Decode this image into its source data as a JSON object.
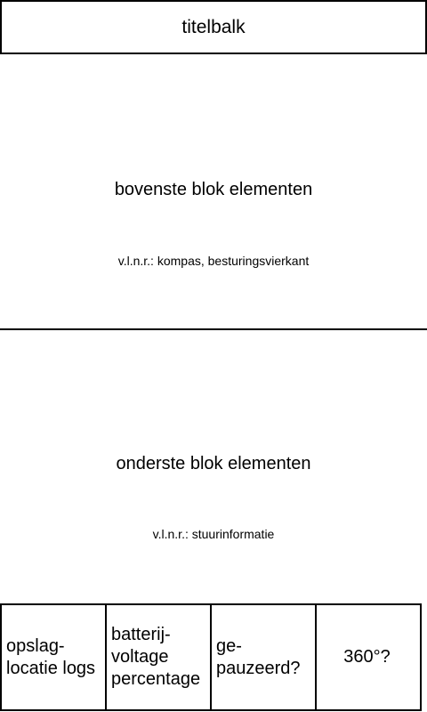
{
  "titlebar": {
    "label": "titelbalk"
  },
  "top_block": {
    "title": "bovenste blok elementen",
    "subtitle": "v.l.n.r.: kompas, besturingsvierkant"
  },
  "bottom_block": {
    "title": "onderste blok elementen",
    "subtitle": "v.l.n.r.: stuurinformatie"
  },
  "status_row": {
    "cells": [
      {
        "label": "opslag-\nlocatie logs"
      },
      {
        "label": "batterij-\nvoltage\npercentage"
      },
      {
        "label": "ge-\npauzeerd?"
      },
      {
        "label": "360°?"
      }
    ]
  }
}
